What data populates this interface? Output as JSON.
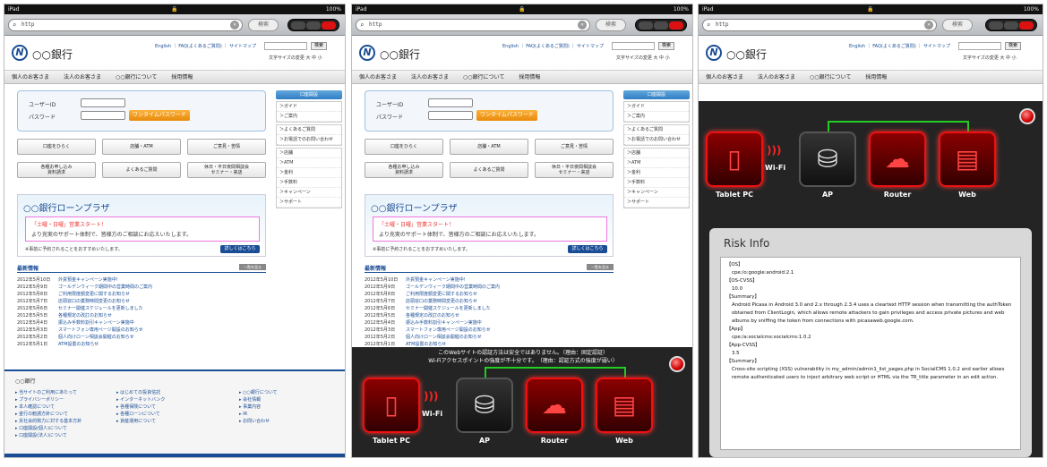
{
  "status": {
    "device": "iPad",
    "battery": "100%"
  },
  "browser": {
    "url": "http",
    "search_label": "検索"
  },
  "site": {
    "bank_name": "○○銀行",
    "top_links": "English ｜ FAQ(よくあるご質問) ｜ サイトマップ",
    "search_btn": "検索",
    "font_size": "文字サイズの変更 大 中 小",
    "nav": [
      "個人のお客さま",
      "法人のお客さま",
      "○○銀行について",
      "採用情報"
    ],
    "login": {
      "user_label": "ユーザーID",
      "pass_label": "パスワード",
      "otp": "ワンタイムパスワード"
    },
    "side": {
      "header": "口座開設",
      "sec1": [
        "＞ガイド",
        "＞ご案内"
      ],
      "sec2": [
        "＞よくあるご質問",
        "＞お電話でのお問い合わせ"
      ],
      "sec3": [
        "＞店舗",
        "＞ATM",
        "＞金利",
        "＞手数料",
        "＞キャンペーン",
        "＞サポート"
      ]
    },
    "buttons": [
      "口座をひらく",
      "店舗・ATM",
      "ご意見・苦情",
      "各種お申し込み\n資料請求",
      "よくあるご質問",
      "休日・平日夜間相談会\nセミナー・来店"
    ],
    "plaza": {
      "title": "○○銀行ローンプラザ",
      "red": "「土曜・日曜」営業スタート！",
      "line": "より充実のサポート体制で、皆様方のご相談にお応えいたします。",
      "note": "※事前に予約されることをおすすめいたします。",
      "more": "詳しくはこちら"
    },
    "news": {
      "title": "最新情報",
      "all": "一覧を見る",
      "items": [
        {
          "date": "2012年5月10日",
          "text": "外貨預金キャンペーン実施中!"
        },
        {
          "date": "2012年5月9日",
          "text": "ゴールデンウィーク期間中の営業時間のご案内"
        },
        {
          "date": "2012年5月8日",
          "text": "ご利用限度額変更に関するお知らせ"
        },
        {
          "date": "2012年5月7日",
          "text": "店頭窓口の業務時間変更のお知らせ"
        },
        {
          "date": "2012年5月6日",
          "text": "セミナー開催スケジュールを更新しました"
        },
        {
          "date": "2012年5月5日",
          "text": "各種規定の改訂のお知らせ"
        },
        {
          "date": "2012年5月4日",
          "text": "振込み手数料割引キャンペーン実施中"
        },
        {
          "date": "2012年5月3日",
          "text": "スマートフォン専用ページ開設のお知らせ"
        },
        {
          "date": "2012年5月2日",
          "text": "個人向けローン相談会開催のお知らせ"
        },
        {
          "date": "2012年5月1日",
          "text": "ATM設置のお知らせ"
        }
      ]
    },
    "footer": {
      "title": "○○銀行",
      "col1": [
        "▸ 当サイトのご利用にあたって",
        "▸ プライバシーポリシー",
        "▸ 本人確認について",
        "▸ 金行の勧誘方針について",
        "▸ 反社会的勢力に対する基本方針",
        "▸ 口座開設(個人)について",
        "▸ 口座開設(法人)について"
      ],
      "col2": [
        "▸ はじめての投資信託",
        "▸ インターネットバンク",
        "▸ 各種保険について",
        "▸ 各種ローンについて",
        "▸ 資産運用について"
      ],
      "col3": [
        "▸ ○○銀行について",
        "▸ 会社情報",
        "▸ 事業内容",
        "▸ IR",
        "▸ お問い合わせ"
      ]
    }
  },
  "warning": {
    "line1": "このWebサイトの認証方法は安全ではありません。（理由：固定認証）",
    "line2": "Wi-Fiアクセスポイントの強度が不十分です。　（理由：認証方式の強度が弱い）"
  },
  "diagram": {
    "nodes": [
      "Tablet PC",
      "AP",
      "Router",
      "Web"
    ],
    "wifi": "Wi-Fi"
  },
  "risk": {
    "title": "Risk Info",
    "lines": [
      "【OS】",
      "cpe:/o:google:android:2.1",
      "【OS-CVSS】",
      "10.0",
      "【Summary】",
      "Android Picasa in Android 3.0 and 2.x through 2.3.4 uses a cleartext HTTP session when transmitting the authToken obtained from ClientLogin, which allows remote attackers to gain privileges and access private pictures and web albums by sniffing the token from connections with picasaweb.google.com.",
      "【App】",
      "cpe:/a:socialcms:socialcms:1.0.2",
      "【App-CVSS】",
      "3.5",
      "【Summary】",
      "Cross-site scripting (XSS) vulnerability in my_admin/admin1_list_pages.php in SocialCMS 1.0.2 and earlier allows remote authenticated users to inject arbitrary web script or HTML via the TR_title parameter in an edit action."
    ]
  }
}
